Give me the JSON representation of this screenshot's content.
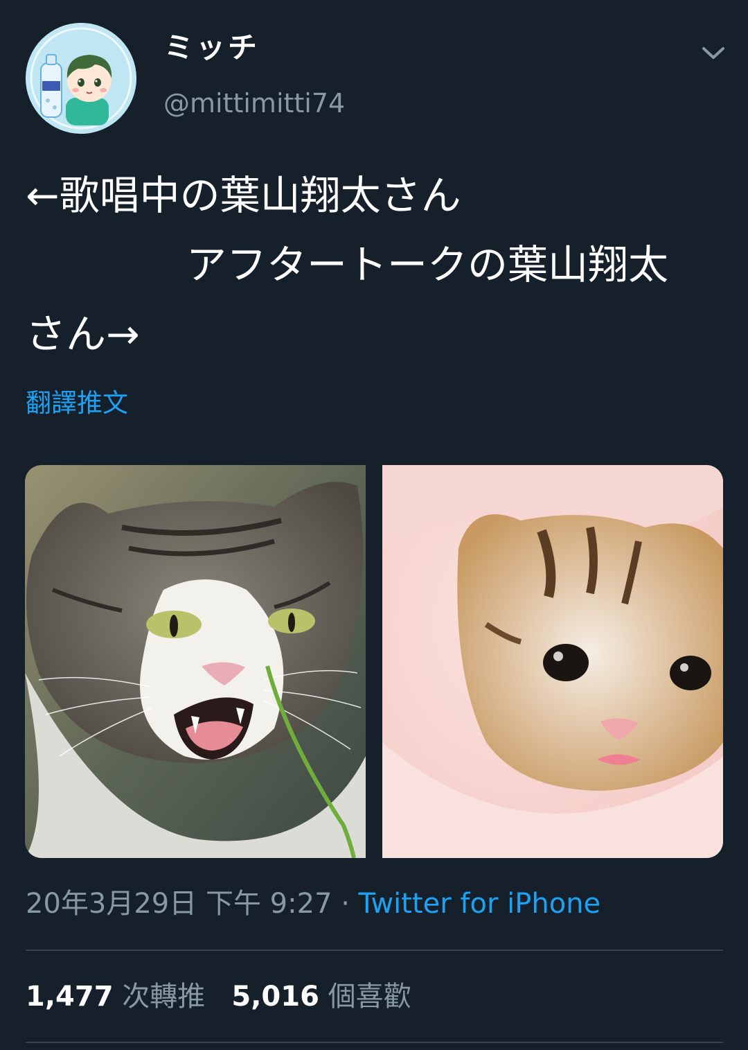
{
  "author": {
    "display_name": "ミッチ",
    "handle": "@mittimitti74"
  },
  "tweet": {
    "text": "←歌唱中の葉山翔太さん\n　　　　アフタートークの葉山翔太\nさん→",
    "translate_label": "翻譯推文"
  },
  "media": [
    {
      "alt": "angry tabby cat hissing"
    },
    {
      "alt": "calico kitten in pink blanket"
    }
  ],
  "meta": {
    "datetime": "20年3月29日 下午 9:27",
    "separator": " · ",
    "source": "Twitter for iPhone"
  },
  "stats": {
    "retweets_count": "1,477",
    "retweets_label": "次轉推",
    "likes_count": "5,016",
    "likes_label": "個喜歡"
  },
  "colors": {
    "background": "#15202b",
    "accent": "#1da1f2",
    "secondary_text": "#8899a6",
    "divider": "#38444d"
  },
  "icons": {
    "more_menu": "chevron-down-icon"
  }
}
